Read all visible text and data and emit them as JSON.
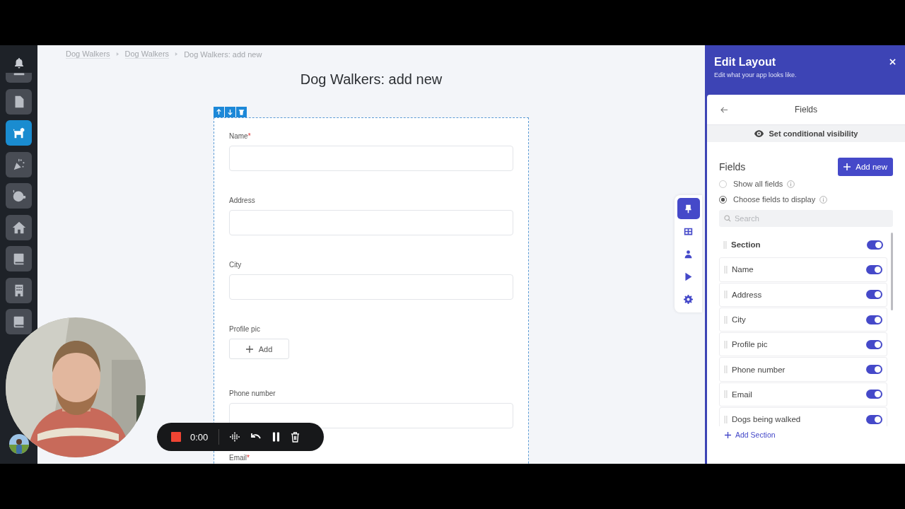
{
  "sidebar": {
    "items": [
      {
        "kind": "list",
        "selected": false
      },
      {
        "kind": "file",
        "selected": false
      },
      {
        "kind": "dog",
        "selected": true
      },
      {
        "kind": "party",
        "selected": false
      },
      {
        "kind": "blob",
        "selected": false
      },
      {
        "kind": "home",
        "selected": false
      },
      {
        "kind": "book",
        "selected": false
      },
      {
        "kind": "building",
        "selected": false
      },
      {
        "kind": "book",
        "selected": false
      }
    ]
  },
  "breadcrumbs": [
    "Dog Walkers",
    "Dog Walkers",
    "Dog Walkers: add new"
  ],
  "page_title": "Dog Walkers: add new",
  "form": {
    "required_mark": "*",
    "fields": [
      {
        "label": "Name",
        "required": true,
        "kind": "text"
      },
      {
        "label": "Address",
        "required": false,
        "kind": "text"
      },
      {
        "label": "City",
        "required": false,
        "kind": "text"
      },
      {
        "label": "Profile pic",
        "required": false,
        "kind": "file",
        "button": "Add"
      },
      {
        "label": "Phone number",
        "required": false,
        "kind": "text"
      },
      {
        "label": "Email",
        "required": true,
        "kind": "text"
      }
    ]
  },
  "tool_tabs": [
    {
      "kind": "brush",
      "selected": true
    },
    {
      "kind": "table",
      "selected": false
    },
    {
      "kind": "person",
      "selected": false
    },
    {
      "kind": "play",
      "selected": false
    },
    {
      "kind": "gear",
      "selected": false
    }
  ],
  "recorder": {
    "time": "0:00"
  },
  "panel": {
    "title": "Edit Layout",
    "subtitle": "Edit what your app looks like.",
    "section_title": "Fields",
    "visibility_button": "Set conditional visibility",
    "heading": "Fields",
    "add_button": "Add new",
    "options": [
      {
        "label": "Show all fields",
        "selected": false
      },
      {
        "label": "Choose fields to display",
        "selected": true
      }
    ],
    "search": {
      "placeholder": "Search"
    },
    "rows": [
      {
        "label": "Section",
        "kind": "section",
        "on": true
      },
      {
        "label": "Name",
        "kind": "field",
        "on": true
      },
      {
        "label": "Address",
        "kind": "field",
        "on": true
      },
      {
        "label": "City",
        "kind": "field",
        "on": true
      },
      {
        "label": "Profile pic",
        "kind": "field",
        "on": true
      },
      {
        "label": "Phone number",
        "kind": "field",
        "on": true
      },
      {
        "label": "Email",
        "kind": "field",
        "on": true
      },
      {
        "label": "Dogs being walked",
        "kind": "field",
        "on": true
      }
    ],
    "add_section": "Add Section"
  }
}
